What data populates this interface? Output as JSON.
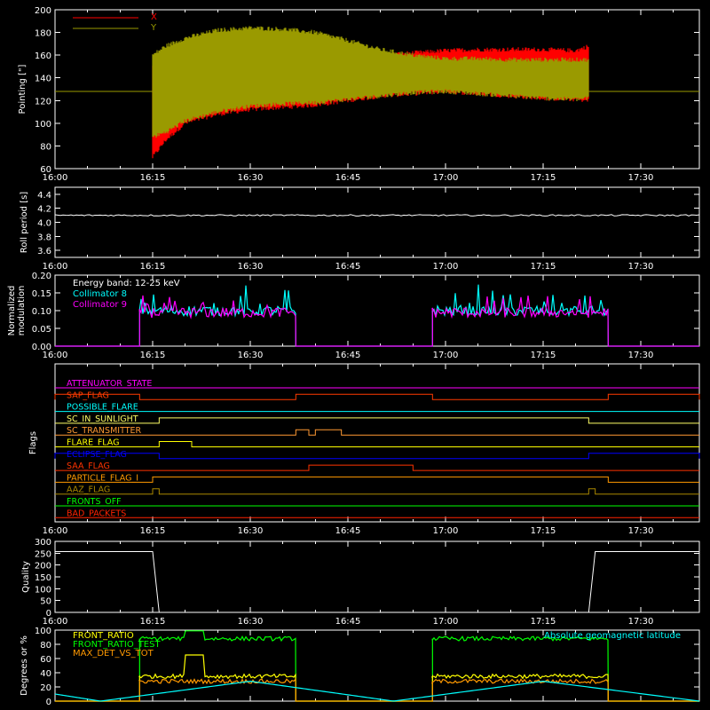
{
  "chart_data": [
    {
      "type": "line",
      "ylabel": "Pointing [\"]",
      "ylim": [
        60,
        200
      ],
      "yticks": [
        60,
        80,
        100,
        120,
        140,
        160,
        180,
        200
      ],
      "x_ticks": [
        "16:00",
        "16:15",
        "16:30",
        "16:45",
        "17:00",
        "17:15",
        "17:30"
      ],
      "x_range": [
        "16:00",
        "17:39"
      ],
      "legend": [
        {
          "name": "X",
          "color": "#ff0000"
        },
        {
          "name": "Y",
          "color": "#9a9a00"
        }
      ],
      "series": [
        {
          "name": "X",
          "color": "#ff0000",
          "x": [
            "16:15",
            "16:17",
            "16:20",
            "16:25",
            "16:30",
            "16:35",
            "16:40",
            "16:45",
            "16:50",
            "16:55",
            "17:00",
            "17:05",
            "17:10",
            "17:15",
            "17:20",
            "17:22"
          ],
          "min": [
            70,
            85,
            100,
            108,
            112,
            114,
            116,
            120,
            124,
            126,
            128,
            126,
            124,
            122,
            121,
            120
          ],
          "max": [
            150,
            150,
            150,
            150,
            152,
            153,
            154,
            156,
            160,
            162,
            164,
            165,
            165,
            165,
            164,
            168
          ]
        },
        {
          "name": "Y",
          "color": "#9a9a00",
          "x": [
            "16:15",
            "16:17",
            "16:20",
            "16:25",
            "16:30",
            "16:35",
            "16:40",
            "16:45",
            "16:50",
            "16:55",
            "17:00",
            "17:05",
            "17:10",
            "17:15",
            "17:20",
            "17:22"
          ],
          "min": [
            88,
            92,
            102,
            110,
            115,
            117,
            118,
            121,
            124,
            127,
            128,
            126,
            124,
            122,
            121,
            122
          ],
          "max": [
            160,
            168,
            175,
            182,
            184,
            183,
            180,
            173,
            165,
            160,
            157,
            157,
            156,
            156,
            156,
            156
          ]
        }
      ]
    },
    {
      "type": "line",
      "ylabel": "Roll period [s]",
      "ylim": [
        3.5,
        4.5
      ],
      "yticks": [
        3.6,
        3.8,
        4.0,
        4.2,
        4.4
      ],
      "x_ticks": [
        "16:00",
        "16:15",
        "16:30",
        "16:45",
        "17:00",
        "17:15",
        "17:30"
      ],
      "series": [
        {
          "name": "Roll period",
          "color": "#ffffff",
          "x": [
            "16:00",
            "17:39"
          ],
          "y": [
            4.1,
            4.1
          ]
        }
      ]
    },
    {
      "type": "line",
      "ylabel": "Normalized modulation",
      "ylim": [
        0,
        0.2
      ],
      "yticks": [
        0.0,
        0.05,
        0.1,
        0.15,
        0.2
      ],
      "x_ticks": [
        "16:00",
        "16:15",
        "16:30",
        "16:45",
        "17:00",
        "17:15",
        "17:30"
      ],
      "annotation": "Energy band: 12-25 keV",
      "legend": [
        {
          "name": "Collimator 8",
          "color": "#00ffff"
        },
        {
          "name": "Collimator 9",
          "color": "#ff00ff"
        }
      ],
      "segments": [
        [
          "16:13",
          "16:37"
        ],
        [
          "16:58",
          "17:25"
        ]
      ],
      "series": [
        {
          "name": "Collimator 8",
          "color": "#00ffff",
          "level": 0.1,
          "max": 0.16
        },
        {
          "name": "Collimator 9",
          "color": "#ff00ff",
          "level": 0.095,
          "max": 0.13
        }
      ]
    },
    {
      "type": "line",
      "ylabel": "Flags",
      "x_ticks": [
        "16:00",
        "16:15",
        "16:30",
        "16:45",
        "17:00",
        "17:15",
        "17:30"
      ],
      "flags": [
        {
          "name": "ATTENUATOR_STATE",
          "color": "#ff00ff",
          "on": []
        },
        {
          "name": "SAP_FLAG",
          "color": "#ff3b00",
          "on": [
            [
              "16:00",
              "16:13"
            ],
            [
              "16:37",
              "16:58"
            ],
            [
              "17:25",
              "17:39"
            ]
          ]
        },
        {
          "name": "POSSIBLE_FLARE",
          "color": "#00ffff",
          "on": []
        },
        {
          "name": "SC_IN_SUNLIGHT",
          "color": "#ffff66",
          "on": [
            [
              "16:16",
              "17:22"
            ]
          ]
        },
        {
          "name": "SC_TRANSMITTER",
          "color": "#ff9933",
          "on": [
            [
              "16:37",
              "16:39"
            ],
            [
              "16:40",
              "16:44"
            ]
          ]
        },
        {
          "name": "FLARE_FLAG",
          "color": "#ffff00",
          "on": [
            [
              "16:16",
              "16:21"
            ]
          ]
        },
        {
          "name": "ECLIPSE_FLAG",
          "color": "#0000ff",
          "on": [
            [
              "16:00",
              "16:16"
            ],
            [
              "17:22",
              "17:39"
            ]
          ]
        },
        {
          "name": "SAA_FLAG",
          "color": "#ff3300",
          "on": [
            [
              "16:39",
              "16:55"
            ]
          ]
        },
        {
          "name": "PARTICLE_FLAG_I",
          "color": "#ff9900",
          "on": [
            [
              "16:15",
              "17:25"
            ]
          ]
        },
        {
          "name": "AAZ_FLAG",
          "color": "#aa8800",
          "on": [
            [
              "16:15",
              "16:16"
            ],
            [
              "17:22",
              "17:23"
            ]
          ]
        },
        {
          "name": "FRONTS_OFF",
          "color": "#00ff00",
          "on": []
        },
        {
          "name": "BAD_PACKETS",
          "color": "#ff2200",
          "on": []
        }
      ]
    },
    {
      "type": "line",
      "ylabel": "Quality",
      "ylim": [
        0,
        300
      ],
      "yticks": [
        0,
        50,
        100,
        150,
        200,
        250,
        300
      ],
      "x_ticks": [
        "16:00",
        "16:15",
        "16:30",
        "16:45",
        "17:00",
        "17:15",
        "17:30"
      ],
      "series": [
        {
          "name": "Quality",
          "color": "#ffffff",
          "x": [
            "16:00",
            "16:15",
            "16:16",
            "17:22",
            "17:23",
            "17:39"
          ],
          "y": [
            257,
            257,
            0,
            0,
            257,
            257
          ]
        }
      ]
    },
    {
      "type": "line",
      "ylabel": "Degrees or %",
      "ylim": [
        0,
        100
      ],
      "yticks": [
        0,
        20,
        40,
        60,
        80,
        100
      ],
      "x_ticks": [
        "16:00",
        "16:15",
        "16:30",
        "16:45",
        "17:00",
        "17:15",
        "17:30"
      ],
      "legend": [
        {
          "name": "FRONT_RATIO",
          "color": "#ffff00"
        },
        {
          "name": "FRONT_RATIO_TEST",
          "color": "#00ff00"
        },
        {
          "name": "MAX_DET_VS_TOT",
          "color": "#ff9900"
        }
      ],
      "annotation": "Absolute geomagnetic latitude",
      "annotation_color": "#00ffff",
      "series": [
        {
          "name": "FRONT_RATIO_TEST",
          "color": "#00ff00",
          "segments": [
            [
              "16:13",
              "16:37"
            ],
            [
              "16:58",
              "17:25"
            ]
          ],
          "level": 88
        },
        {
          "name": "FRONT_RATIO",
          "color": "#ffff00",
          "segments": [
            [
              "16:13",
              "16:37"
            ],
            [
              "16:58",
              "17:25"
            ]
          ],
          "level": 35
        },
        {
          "name": "MAX_DET_VS_TOT",
          "color": "#ff9900",
          "segments": [
            [
              "16:13",
              "16:37"
            ],
            [
              "16:58",
              "17:25"
            ]
          ],
          "level": 28
        },
        {
          "name": "Absolute geomagnetic latitude",
          "color": "#00ffff",
          "x": [
            "16:00",
            "16:07",
            "16:30",
            "16:52",
            "17:15",
            "17:39"
          ],
          "y": [
            10,
            0,
            28,
            0,
            28,
            0
          ]
        }
      ]
    }
  ]
}
